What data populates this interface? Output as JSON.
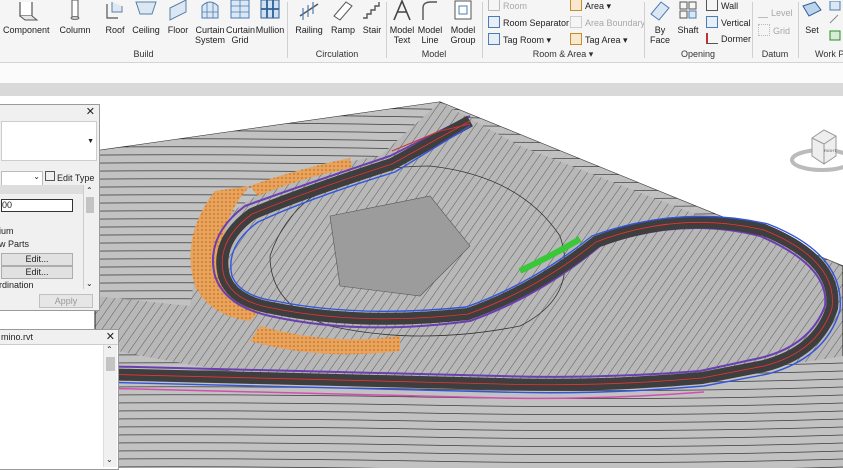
{
  "ribbon": {
    "build": {
      "label": "Build",
      "buttons": [
        "Component",
        "Column",
        "Roof",
        "Ceiling",
        "Floor",
        "Curtain\nSystem",
        "Curtain\nGrid",
        "Mullion"
      ]
    },
    "circulation": {
      "label": "Circulation",
      "buttons": [
        "Railing",
        "Ramp",
        "Stair"
      ]
    },
    "model": {
      "label": "Model",
      "buttons": [
        "Model\nText",
        "Model\nLine",
        "Model\nGroup"
      ]
    },
    "room_area": {
      "label": "Room & Area",
      "room": "Room",
      "room_separator": "Room Separator",
      "tag_room": "Tag Room",
      "area": "Area",
      "area_boundary": "Area Boundary",
      "tag_area": "Tag Area"
    },
    "opening": {
      "label": "Opening",
      "by_face": "By\nFace",
      "shaft": "Shaft",
      "wall": "Wall",
      "vertical": "Vertical",
      "dormer": "Dormer"
    },
    "datum": {
      "label": "Datum",
      "level": "Level",
      "grid": "Grid"
    },
    "work_plane": {
      "label": "Work P",
      "set": "Set"
    }
  },
  "properties": {
    "close": "✕",
    "edit_type": "Edit Type",
    "value_field": "00",
    "rows": [
      "ium",
      "w Parts",
      "rdination"
    ],
    "edit1": "Edit...",
    "edit2": "Edit...",
    "apply": "Apply"
  },
  "browser": {
    "title": "mino.rvt",
    "close": "✕"
  },
  "viewcube": {
    "face": "RIGHT"
  }
}
